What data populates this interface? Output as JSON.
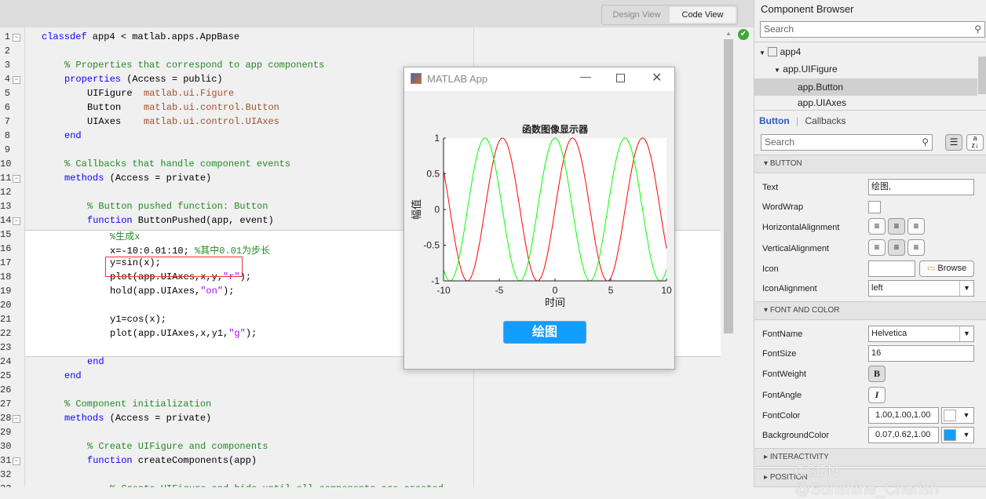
{
  "header": {
    "design_view": "Design View",
    "code_view": "Code View"
  },
  "editor": {
    "lines": [
      {
        "n": "1",
        "fold": true,
        "indent": 0,
        "tokens": [
          [
            "classdef",
            "k"
          ],
          [
            " app4 < matlab.apps.AppBase",
            ""
          ]
        ]
      },
      {
        "n": "2",
        "indent": 0,
        "tokens": []
      },
      {
        "n": "3",
        "indent": 4,
        "tokens": [
          [
            "% Properties that correspond to app components",
            "c"
          ]
        ]
      },
      {
        "n": "4",
        "fold": true,
        "indent": 4,
        "tokens": [
          [
            "properties",
            "k"
          ],
          [
            " (Access = public)",
            ""
          ]
        ]
      },
      {
        "n": "5",
        "indent": 8,
        "tokens": [
          [
            "UIFigure  ",
            ""
          ],
          [
            "matlab.ui.Figure",
            "t"
          ]
        ]
      },
      {
        "n": "6",
        "indent": 8,
        "tokens": [
          [
            "Button    ",
            ""
          ],
          [
            "matlab.ui.control.Button",
            "t"
          ]
        ]
      },
      {
        "n": "7",
        "indent": 8,
        "tokens": [
          [
            "UIAxes    ",
            ""
          ],
          [
            "matlab.ui.control.UIAxes",
            "t"
          ]
        ]
      },
      {
        "n": "8",
        "indent": 4,
        "tokens": [
          [
            "end",
            "k"
          ]
        ]
      },
      {
        "n": "9",
        "indent": 0,
        "tokens": []
      },
      {
        "n": "10",
        "indent": 4,
        "tokens": [
          [
            "% Callbacks that handle component events",
            "c"
          ]
        ]
      },
      {
        "n": "11",
        "fold": true,
        "indent": 4,
        "tokens": [
          [
            "methods",
            "k"
          ],
          [
            " (Access = private)",
            ""
          ]
        ]
      },
      {
        "n": "12",
        "indent": 0,
        "tokens": []
      },
      {
        "n": "13",
        "indent": 8,
        "tokens": [
          [
            "% Button pushed function: Button",
            "c"
          ]
        ]
      },
      {
        "n": "14",
        "fold": true,
        "indent": 8,
        "tokens": [
          [
            "function",
            "k"
          ],
          [
            " ButtonPushed(app, event)",
            ""
          ]
        ]
      },
      {
        "n": "15",
        "indent": 12,
        "tokens": [
          [
            "%生成x",
            "c"
          ]
        ]
      },
      {
        "n": "16",
        "indent": 12,
        "tokens": [
          [
            "x=-10:0.01:10; ",
            ""
          ],
          [
            "%其中0.01为步长",
            "c"
          ]
        ]
      },
      {
        "n": "17",
        "indent": 12,
        "tokens": [
          [
            "y=sin(x);",
            ""
          ]
        ]
      },
      {
        "n": "18",
        "indent": 12,
        "tokens": [
          [
            "plot(app.UIAxes,x,y,",
            ""
          ],
          [
            "\"r\"",
            "s"
          ],
          [
            ");",
            ""
          ]
        ]
      },
      {
        "n": "19",
        "indent": 12,
        "tokens": [
          [
            "hold(app.UIAxes,",
            ""
          ],
          [
            "\"on\"",
            "s"
          ],
          [
            ");",
            ""
          ]
        ]
      },
      {
        "n": "20",
        "indent": 0,
        "tokens": []
      },
      {
        "n": "21",
        "indent": 12,
        "tokens": [
          [
            "y1=cos(x);",
            ""
          ]
        ]
      },
      {
        "n": "22",
        "indent": 12,
        "tokens": [
          [
            "plot(app.UIAxes,x,y1,",
            ""
          ],
          [
            "\"g\"",
            "s"
          ],
          [
            ");",
            ""
          ]
        ]
      },
      {
        "n": "23",
        "indent": 0,
        "tokens": []
      },
      {
        "n": "24",
        "indent": 8,
        "tokens": [
          [
            "end",
            "k"
          ]
        ]
      },
      {
        "n": "25",
        "indent": 4,
        "tokens": [
          [
            "end",
            "k"
          ]
        ]
      },
      {
        "n": "26",
        "indent": 0,
        "tokens": []
      },
      {
        "n": "27",
        "indent": 4,
        "tokens": [
          [
            "% Component initialization",
            "c"
          ]
        ]
      },
      {
        "n": "28",
        "fold": true,
        "indent": 4,
        "tokens": [
          [
            "methods",
            "k"
          ],
          [
            " (Access = private)",
            ""
          ]
        ]
      },
      {
        "n": "29",
        "indent": 0,
        "tokens": []
      },
      {
        "n": "30",
        "indent": 8,
        "tokens": [
          [
            "% Create UIFigure and components",
            "c"
          ]
        ]
      },
      {
        "n": "31",
        "fold": true,
        "indent": 8,
        "tokens": [
          [
            "function",
            "k"
          ],
          [
            " createComponents(app)",
            ""
          ]
        ]
      },
      {
        "n": "32",
        "indent": 0,
        "tokens": []
      },
      {
        "n": "33",
        "indent": 12,
        "tokens": [
          [
            "% Create UIFigure and hide until all components are created",
            "c"
          ]
        ]
      }
    ]
  },
  "app_window": {
    "title": "MATLAB App",
    "button_label": "绘图",
    "button_color": "#129eff"
  },
  "chart_data": {
    "type": "line",
    "title": "函数图像显示器",
    "xlabel": "时间",
    "ylabel": "幅值",
    "xlim": [
      -10,
      10
    ],
    "ylim": [
      -1,
      1
    ],
    "xticks": [
      -10,
      -5,
      0,
      5,
      10
    ],
    "yticks": [
      -1,
      -0.5,
      0,
      0.5,
      1
    ],
    "xticklabels": [
      "-10",
      "-5",
      "0",
      "5",
      "10"
    ],
    "yticklabels": [
      "-1",
      "-0.5",
      "0",
      "0.5",
      "1"
    ],
    "x": {
      "start": -10,
      "step": 0.01,
      "end": 10
    },
    "series": [
      {
        "expr": "sin(x)",
        "color": "#ff0000"
      },
      {
        "expr": "cos(x)",
        "color": "#00ff00"
      }
    ],
    "grid": false
  },
  "component_browser": {
    "title": "Component Browser",
    "search_placeholder": "Search",
    "tree": [
      {
        "label": "app4"
      },
      {
        "label": "app.UIFigure"
      },
      {
        "label": "app.Button",
        "selected": true
      },
      {
        "label": "app.UIAxes"
      }
    ]
  },
  "inspector": {
    "tabs": [
      "Button",
      "Callbacks"
    ],
    "search_placeholder": "Search",
    "sections": {
      "button": "BUTTON",
      "font": "FONT AND COLOR",
      "interactivity": "INTERACTIVITY",
      "position": "POSITION"
    },
    "props": {
      "text": {
        "label": "Text",
        "value": "绘图,"
      },
      "wordwrap": {
        "label": "WordWrap",
        "checked": false
      },
      "halign": {
        "label": "HorizontalAlignment",
        "value": "center"
      },
      "valign": {
        "label": "VerticalAlignment",
        "value": "center"
      },
      "icon": {
        "label": "Icon",
        "value": "",
        "browse": "Browse"
      },
      "iconalign": {
        "label": "IconAlignment",
        "value": "left"
      },
      "fontname": {
        "label": "FontName",
        "value": "Helvetica"
      },
      "fontsize": {
        "label": "FontSize",
        "value": "16"
      },
      "fontweight": {
        "label": "FontWeight",
        "value": "bold"
      },
      "fontangle": {
        "label": "FontAngle"
      },
      "fontcolor": {
        "label": "FontColor",
        "value": "1.00,1.00,1.00",
        "swatch": "#ffffff"
      },
      "bgcolor": {
        "label": "BackgroundColor",
        "value": "0.07,0.62,1.00",
        "swatch": "#129eff"
      }
    }
  },
  "watermark": "CSDN @Sunshine_Cherish"
}
